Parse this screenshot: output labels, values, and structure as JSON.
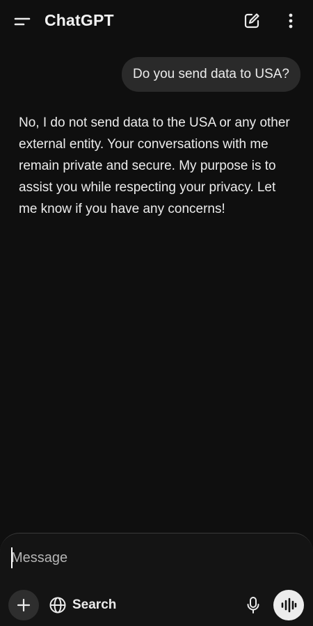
{
  "header": {
    "title": "ChatGPT",
    "menu_icon": "menu-icon",
    "new_chat_icon": "edit-icon",
    "more_icon": "more-vertical-icon"
  },
  "conversation": {
    "user_message": "Do you send data to USA?",
    "assistant_message": "No, I do not send data to the USA or any other external entity. Your conversations with me remain private and secure. My purpose is to assist you while respecting your privacy. Let me know if you have any concerns!"
  },
  "composer": {
    "placeholder": "Message",
    "search_label": "Search",
    "plus_icon": "plus-icon",
    "search_icon": "globe-icon",
    "mic_icon": "microphone-icon",
    "voice_icon": "voice-waveform-icon"
  },
  "colors": {
    "background": "#0f0f0f",
    "bubble": "#2a2a2a",
    "text": "#ececec",
    "voice_button": "#ececec"
  }
}
